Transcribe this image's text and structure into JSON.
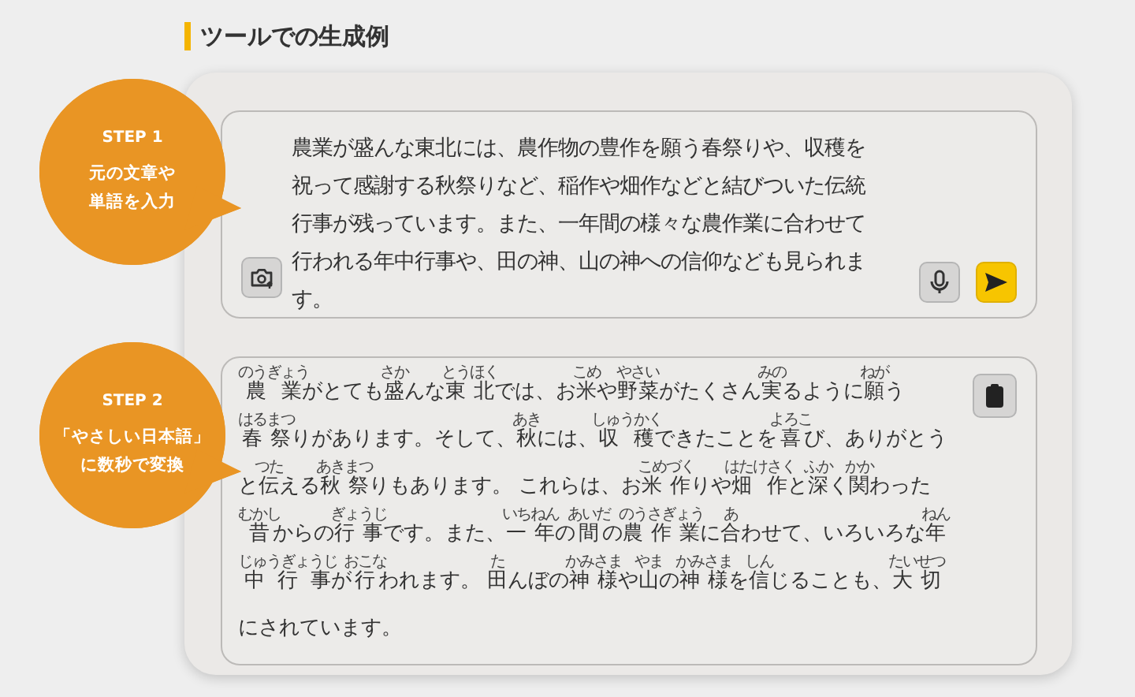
{
  "heading": "ツールでの生成例",
  "steps": [
    {
      "label": "STEP 1",
      "caption": [
        "元の文章や",
        "単語を入力"
      ]
    },
    {
      "label": "STEP 2",
      "caption": [
        "「やさしい日本語」",
        "に数秒で変換"
      ]
    }
  ],
  "input": {
    "value": "農業が盛んな東北には、農作物の豊作を願う春祭りや、収穫を祝って感謝する秋祭りなど、稲作や畑作などと結びついた伝統行事が残っています。また、一年間の様々な農作業に合わせて行われる年中行事や、田の神、山の神への信仰なども見られます。"
  },
  "output": {
    "segments": [
      {
        "text": "農業",
        "ruby": "のうぎょう"
      },
      {
        "text": "がとても"
      },
      {
        "text": "盛",
        "ruby": "さか"
      },
      {
        "text": "んな"
      },
      {
        "text": "東北",
        "ruby": "とうほく"
      },
      {
        "text": "では、お"
      },
      {
        "text": "米",
        "ruby": "こめ"
      },
      {
        "text": "や"
      },
      {
        "text": "野菜",
        "ruby": "やさい"
      },
      {
        "text": "がたくさん"
      },
      {
        "text": "実",
        "ruby": "みの"
      },
      {
        "text": "るように"
      },
      {
        "text": "願",
        "ruby": "ねが"
      },
      {
        "text": "う"
      },
      {
        "text": "春祭",
        "ruby": "はるまつ"
      },
      {
        "text": "りがあります。そして、"
      },
      {
        "text": "秋",
        "ruby": "あき"
      },
      {
        "text": "には、"
      },
      {
        "text": "収穫",
        "ruby": "しゅうかく"
      },
      {
        "text": "できたことを"
      },
      {
        "text": "喜",
        "ruby": "よろこ"
      },
      {
        "text": "び、ありがとうと"
      },
      {
        "text": "伝",
        "ruby": "つた"
      },
      {
        "text": "える"
      },
      {
        "text": "秋祭",
        "ruby": "あきまつ"
      },
      {
        "text": "りもあります。 これらは、お"
      },
      {
        "text": "米作",
        "ruby": "こめづく"
      },
      {
        "text": "りや"
      },
      {
        "text": "畑作",
        "ruby": "はたけさく"
      },
      {
        "text": "と"
      },
      {
        "text": "深",
        "ruby": "ふか"
      },
      {
        "text": "く"
      },
      {
        "text": "関",
        "ruby": "かか"
      },
      {
        "text": "わった"
      },
      {
        "text": "昔",
        "ruby": "むかし"
      },
      {
        "text": "からの"
      },
      {
        "text": "行事",
        "ruby": "ぎょうじ"
      },
      {
        "text": "です。また、"
      },
      {
        "text": "一年",
        "ruby": "いちねん"
      },
      {
        "text": "の"
      },
      {
        "text": "間",
        "ruby": "あいだ"
      },
      {
        "text": "の"
      },
      {
        "text": "農作業",
        "ruby": "のうさぎょう"
      },
      {
        "text": "に"
      },
      {
        "text": "合",
        "ruby": "あ"
      },
      {
        "text": "わせて、いろいろな"
      },
      {
        "text": "年中行事",
        "ruby": "ねんじゅうぎょうじ"
      },
      {
        "text": "が"
      },
      {
        "text": "行",
        "ruby": "おこな"
      },
      {
        "text": "われます。 "
      },
      {
        "text": "田",
        "ruby": "た"
      },
      {
        "text": "んぼの"
      },
      {
        "text": "神様",
        "ruby": "かみさま"
      },
      {
        "text": "や"
      },
      {
        "text": "山",
        "ruby": "やま"
      },
      {
        "text": "の"
      },
      {
        "text": "神様",
        "ruby": "かみさま"
      },
      {
        "text": "を"
      },
      {
        "text": "信",
        "ruby": "しん"
      },
      {
        "text": "じることも、"
      },
      {
        "text": "大切",
        "ruby": "たいせつ"
      },
      {
        "text": "にされています。"
      }
    ]
  }
}
